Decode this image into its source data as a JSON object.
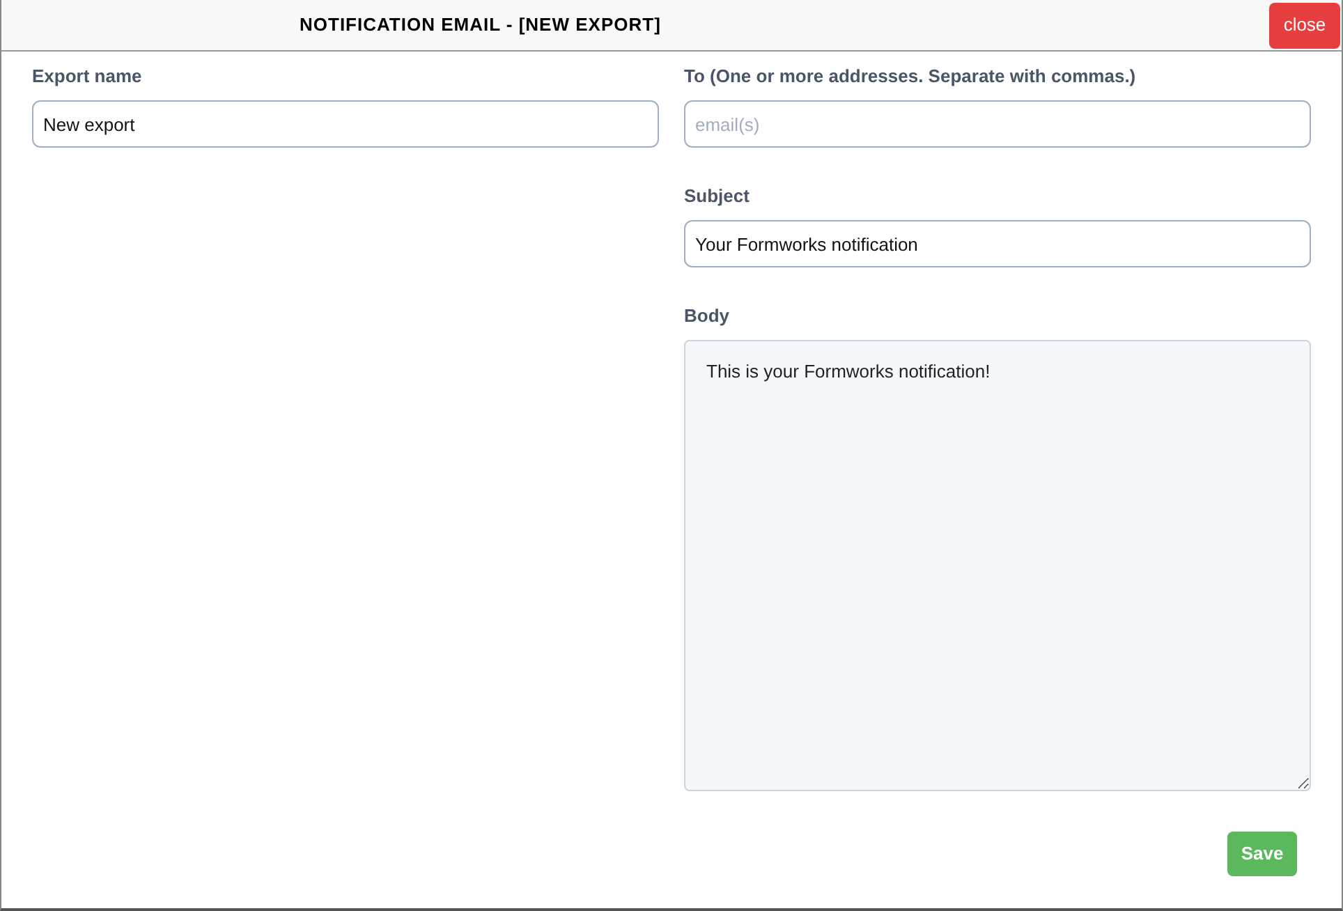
{
  "window": {
    "title": "NOTIFICATION EMAIL - [NEW EXPORT]",
    "close_button": "close"
  },
  "export_name": {
    "label": "Export name",
    "value": "New export"
  },
  "to": {
    "label": "To (One or more addresses. Separate with commas.)",
    "placeholder": "email(s)"
  },
  "subject": {
    "label": "Subject",
    "value": "Your Formworks notification"
  },
  "body": {
    "label": "Body",
    "value": "This is your Formworks notification!"
  },
  "save_button": "Save"
}
